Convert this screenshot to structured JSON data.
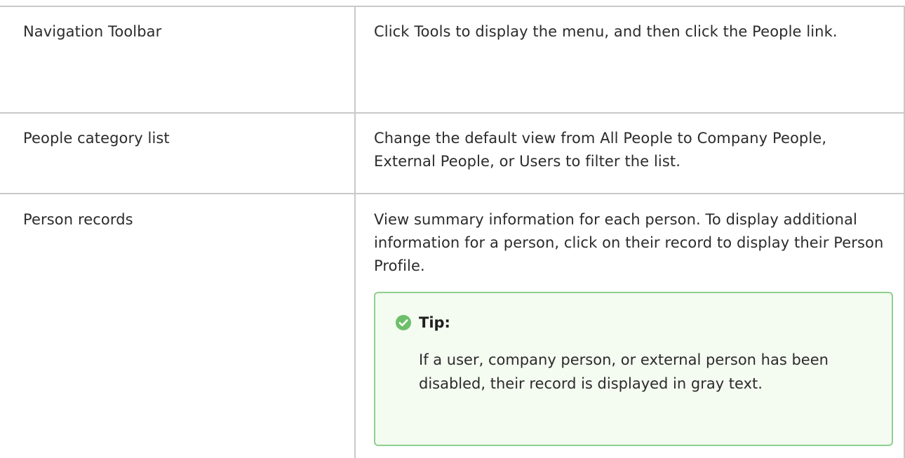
{
  "rows": [
    {
      "item": "Navigation Toolbar",
      "description": "Click Tools to display the menu, and then click the People link."
    },
    {
      "item": "People category list",
      "description": "Change the default view from All People to Company People, External People, or Users to filter the list."
    },
    {
      "item": "Person records",
      "description": "View summary information for each person. To display additional information for a person, click on their record to display their Person Profile."
    }
  ],
  "tip": {
    "title": "Tip:",
    "body": "If a user, company person, or external person has been disabled, their record is displayed in gray text.",
    "icon": "check-circle-icon",
    "accent_color": "#6dbf6a",
    "border_color": "#8ecf8f",
    "background_color": "#f4fbf1"
  },
  "colors": {
    "rule": "#c9c9c9",
    "text": "#2b2b2b"
  }
}
